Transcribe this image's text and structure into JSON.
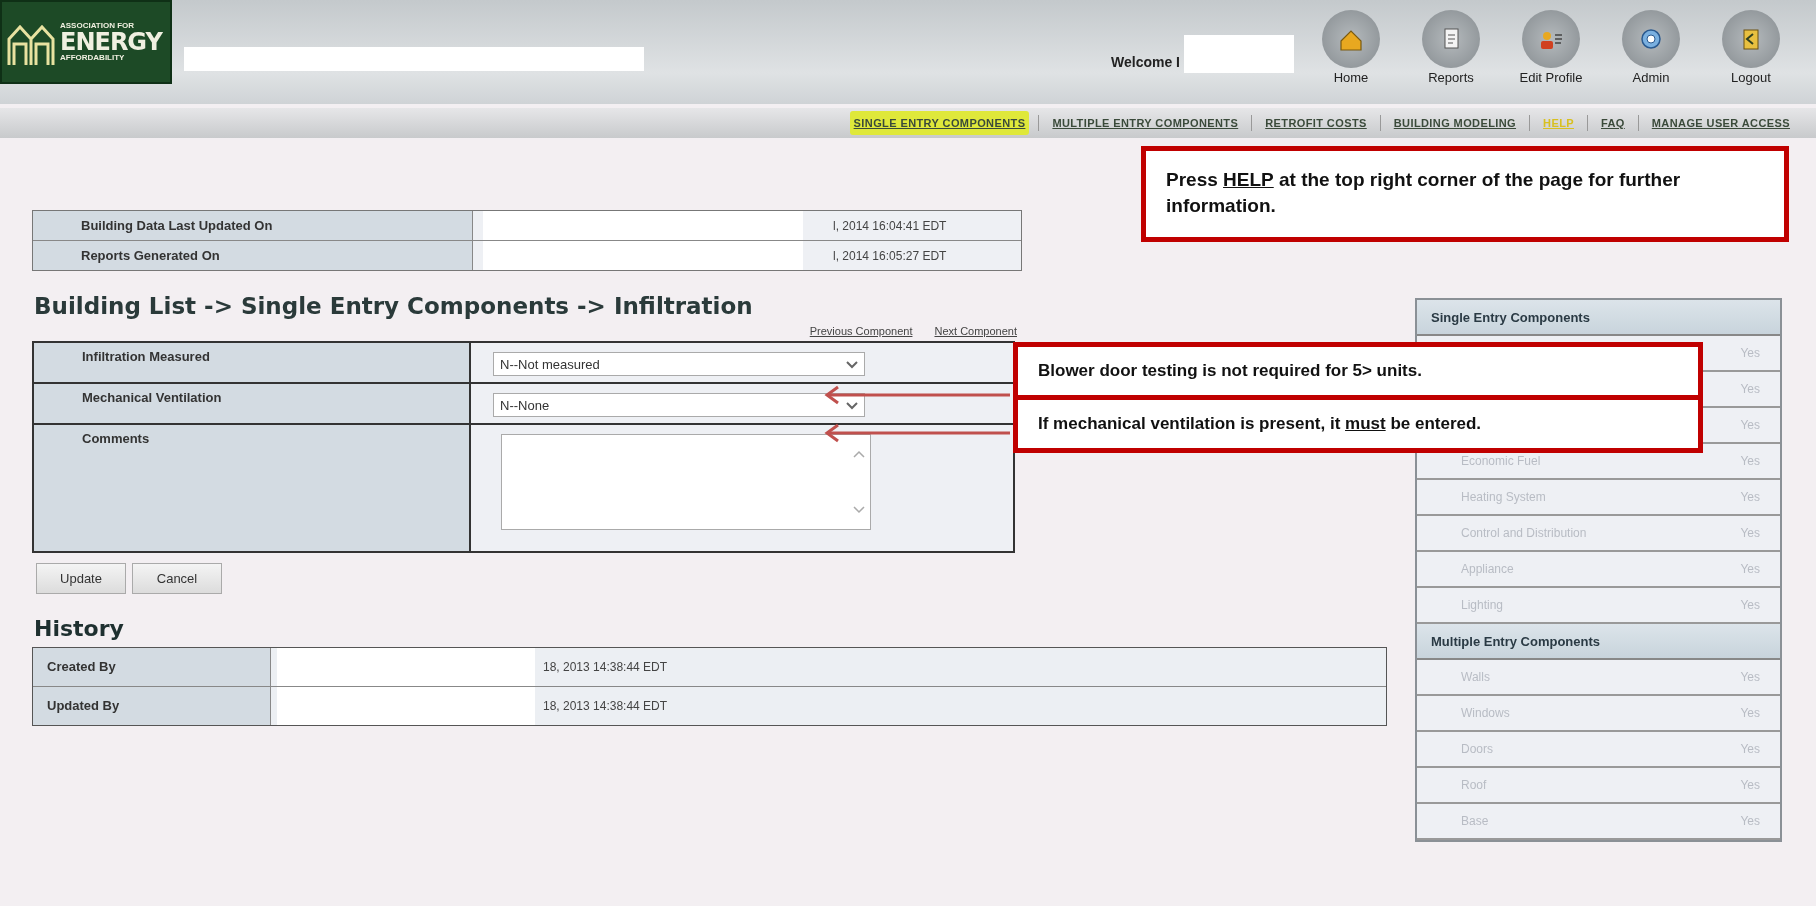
{
  "header": {
    "logo": {
      "line1": "ASSOCIATION FOR",
      "line2": "ENERGY",
      "line3": "AFFORDABILITY"
    },
    "welcome": "Welcome I",
    "toolbar": [
      {
        "kind": "home",
        "label": "Home"
      },
      {
        "kind": "reports",
        "label": "Reports"
      },
      {
        "kind": "profile",
        "label": "Edit Profile"
      },
      {
        "kind": "admin",
        "label": "Admin"
      },
      {
        "kind": "logout",
        "label": "Logout"
      }
    ]
  },
  "nav": [
    {
      "label": "SINGLE ENTRY COMPONENTS",
      "selected": true,
      "emphasized": false
    },
    {
      "label": "MULTIPLE ENTRY COMPONENTS",
      "selected": false,
      "emphasized": false
    },
    {
      "label": "RETROFIT COSTS",
      "selected": false,
      "emphasized": false
    },
    {
      "label": "BUILDING MODELING",
      "selected": false,
      "emphasized": false
    },
    {
      "label": "HELP",
      "selected": false,
      "emphasized": true
    },
    {
      "label": "FAQ",
      "selected": false,
      "emphasized": false
    },
    {
      "label": "MANAGE USER ACCESS",
      "selected": false,
      "emphasized": false
    }
  ],
  "info_table": [
    {
      "label": "Building Data Last Updated On",
      "value": "l, 2014 16:04:41 EDT"
    },
    {
      "label": "Reports Generated On",
      "value": "l, 2014 16:05:27 EDT"
    }
  ],
  "heading": "Building List -> Single Entry Components -> Infiltration",
  "component_links": [
    "Previous Component",
    "Next Component"
  ],
  "form": [
    {
      "kind": "select",
      "label": "Infiltration Measured",
      "value": "N--Not measured"
    },
    {
      "kind": "select",
      "label": "Mechanical Ventilation",
      "value": "N--None"
    },
    {
      "kind": "textarea",
      "label": "Comments"
    }
  ],
  "buttons": [
    "Update",
    "Cancel"
  ],
  "history": {
    "title": "History",
    "rows": [
      {
        "label": "Created By",
        "value": "18, 2013 14:38:44 EDT"
      },
      {
        "label": "Updated By",
        "value": "18, 2013 14:38:44 EDT"
      }
    ]
  },
  "sidebar": [
    {
      "title": "Single Entry Components",
      "items": [
        {
          "status": "Yes"
        },
        {
          "status": "Yes"
        },
        {
          "status": "Yes"
        },
        {
          "label": "Economic Fuel",
          "status": "Yes"
        },
        {
          "label": "Heating System",
          "status": "Yes"
        },
        {
          "label": "Control and Distribution",
          "status": "Yes"
        },
        {
          "label": "Appliance",
          "status": "Yes"
        },
        {
          "label": "Lighting",
          "status": "Yes"
        }
      ]
    },
    {
      "title": "Multiple Entry Components",
      "items": [
        {
          "label": "Walls",
          "status": "Yes"
        },
        {
          "label": "Windows",
          "status": "Yes"
        },
        {
          "label": "Doors",
          "status": "Yes"
        },
        {
          "label": "Roof",
          "status": "Yes"
        },
        {
          "label": "Base",
          "status": "Yes"
        }
      ]
    }
  ],
  "callouts": {
    "help_note": "Press **HELP** at the top right corner of the page for further information.",
    "notes": [
      "Blower door testing is not required for 5> units.",
      "If mechanical ventilation is present, it **must** be entered."
    ]
  }
}
